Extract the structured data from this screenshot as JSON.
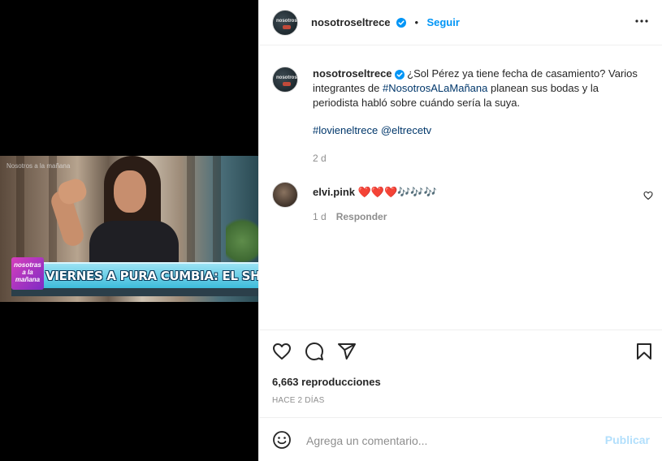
{
  "media": {
    "watermark": "Nosotros a la mañana",
    "show_logo": "nosotras a la mañana",
    "headline": "VIERNES A PURA CUMBIA: EL SHOW DE ANDY"
  },
  "header": {
    "username": "nosotroseltrece",
    "separator": "•",
    "follow_label": "Seguir",
    "avatar_text": "nosotros"
  },
  "caption": {
    "username": "nosotroseltrece",
    "text_1": " ¿Sol Pérez ya tiene fecha de casamiento? Varios integrantes de ",
    "hashtag_1": "#NosotrosALaMañana",
    "text_2": " planean sus bodas y la periodista habló sobre cuándo sería la suya.",
    "hashtag_2": "#lovieneltrece",
    "mention": "@eltrecetv",
    "time": "2 d"
  },
  "comment": {
    "username": "elvi.pink",
    "text": "❤️❤️❤️🎶🎶🎶",
    "time": "1 d",
    "reply_label": "Responder"
  },
  "actions": {
    "views": "6,663 reproducciones",
    "time_ago": "HACE 2 DÍAS"
  },
  "comment_box": {
    "placeholder": "Agrega un comentario...",
    "post_label": "Publicar"
  },
  "colors": {
    "accent": "#0095f6",
    "link": "#00376b",
    "heart": "#ed4956",
    "muted": "#8e8e8e"
  }
}
